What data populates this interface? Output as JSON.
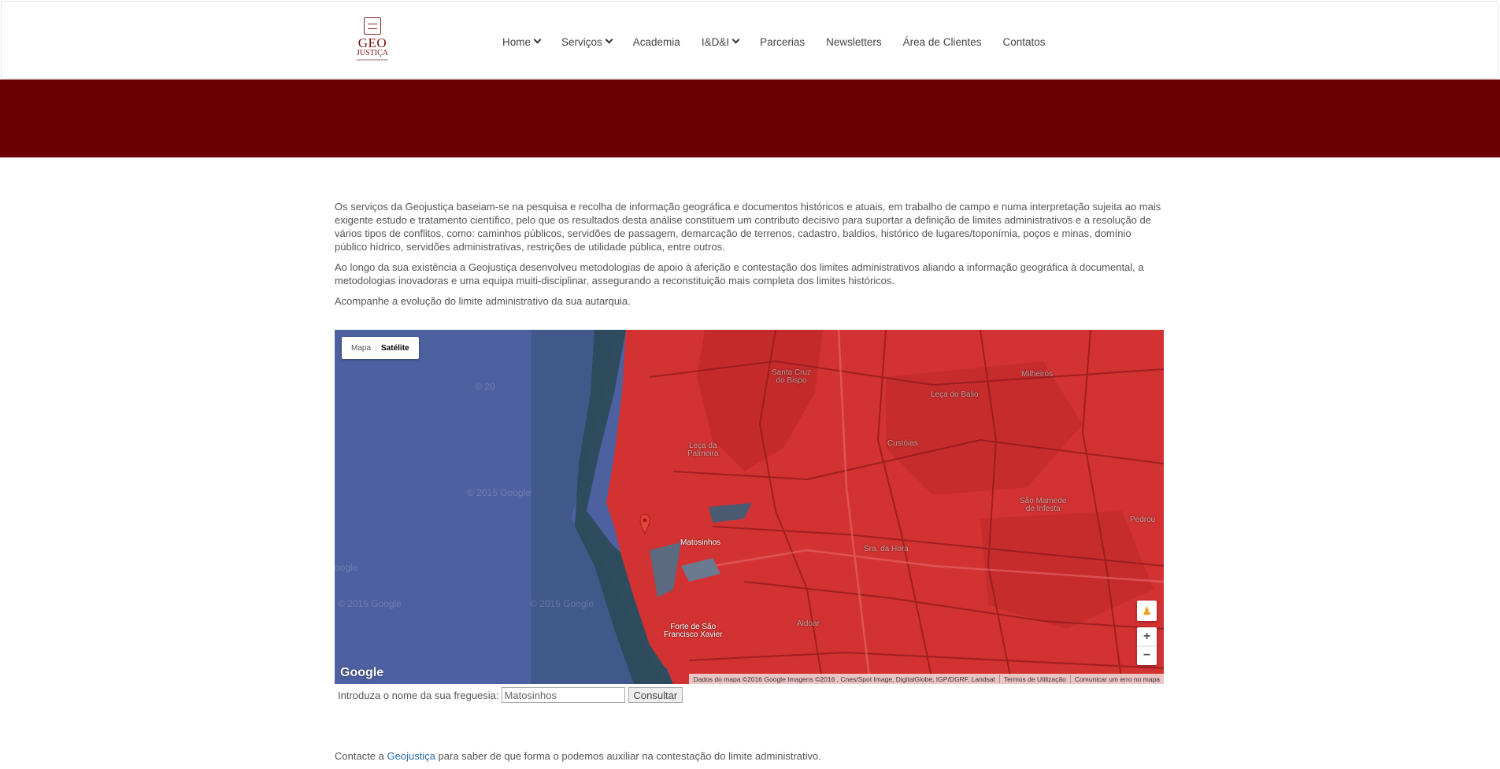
{
  "logo": {
    "line1": "GEO",
    "line2": "JUSTIÇA"
  },
  "nav": {
    "items": [
      {
        "label": "Home",
        "dropdown": true
      },
      {
        "label": "Serviços",
        "dropdown": true
      },
      {
        "label": "Academia",
        "dropdown": false
      },
      {
        "label": "I&D&I",
        "dropdown": true
      },
      {
        "label": "Parcerias",
        "dropdown": false
      },
      {
        "label": "Newsletters",
        "dropdown": false
      },
      {
        "label": "Área de Clientes",
        "dropdown": false
      },
      {
        "label": "Contatos",
        "dropdown": false
      }
    ]
  },
  "colors": {
    "banner": "#6a0004",
    "accent": "#7b1212",
    "link": "#2a6db0",
    "map_overlay": "#d23232"
  },
  "content": {
    "p1": "Os serviços da Geojustiça baseiam-se na pesquisa e recolha de informação geográfica e documentos históricos e atuais, em trabalho de campo e numa interpretação sujeita ao mais exigente estudo e tratamento científico, pelo que os resultados desta análise constituem um contributo decisivo para suportar a definição de limites administrativos e a resolução de vários tipos de conflitos, como: caminhos públicos, servidões de passagem, demarcação de terrenos, cadastro, baldios, histórico de lugares/toponímia, poços e minas, domínio público hídrico, servidões administrativas, restrições de utilidade pública, entre outros.",
    "p2": "Ao longo da sua existência a Geojustiça desenvolveu metodologias de apoio à aferição e contestação dos limites administrativos aliando a informação geográfica à documental, a metodologias inovadoras e uma equipa muiti-disciplinar, assegurando a reconstituição mais completa dos limites históricos.",
    "p3": "Acompanhe a evolução do limite administrativo da sua autarquia."
  },
  "map": {
    "type_map": "Mapa",
    "type_satellite": "Satélite",
    "selected_type": "Satélite",
    "zoom_in": "+",
    "zoom_out": "−",
    "google": "Google",
    "attribution": "Dados do mapa ©2016 Google Imagens ©2016 , Cnes/Spot Image, DigitalGlobe, IGP/DGRF, Landsat",
    "terms": "Termos de Utilização",
    "report": "Comunicar um erro no mapa",
    "places": {
      "santa_cruz_1": "Santa Cruz",
      "santa_cruz_2": "do Bispo",
      "leca_balio": "Leça do Balio",
      "leca_palmeira_1": "Leça da",
      "leca_palmeira_2": "Palmeira",
      "custoias": "Custóias",
      "sao_mamede_1": "São Mamede",
      "sao_mamede_2": "de Infesta",
      "matosinhos": "Matosinhos",
      "sra_hora": "Sra. da Hora",
      "forte_1": "Forte de São",
      "forte_2": "Francisco Xavier",
      "aldoar": "Aldoar",
      "milheiros": "Milheirós",
      "pedrouços": "Pedrou"
    }
  },
  "form": {
    "label": "Introduza o nome da sua freguesia:",
    "value": "Matosinhos",
    "button": "Consultar"
  },
  "contact": {
    "before": "Contacte a",
    "link": "Geojustiça",
    "after": "para saber de que forma o podemos auxiliar na contestação do limite administrativo."
  }
}
